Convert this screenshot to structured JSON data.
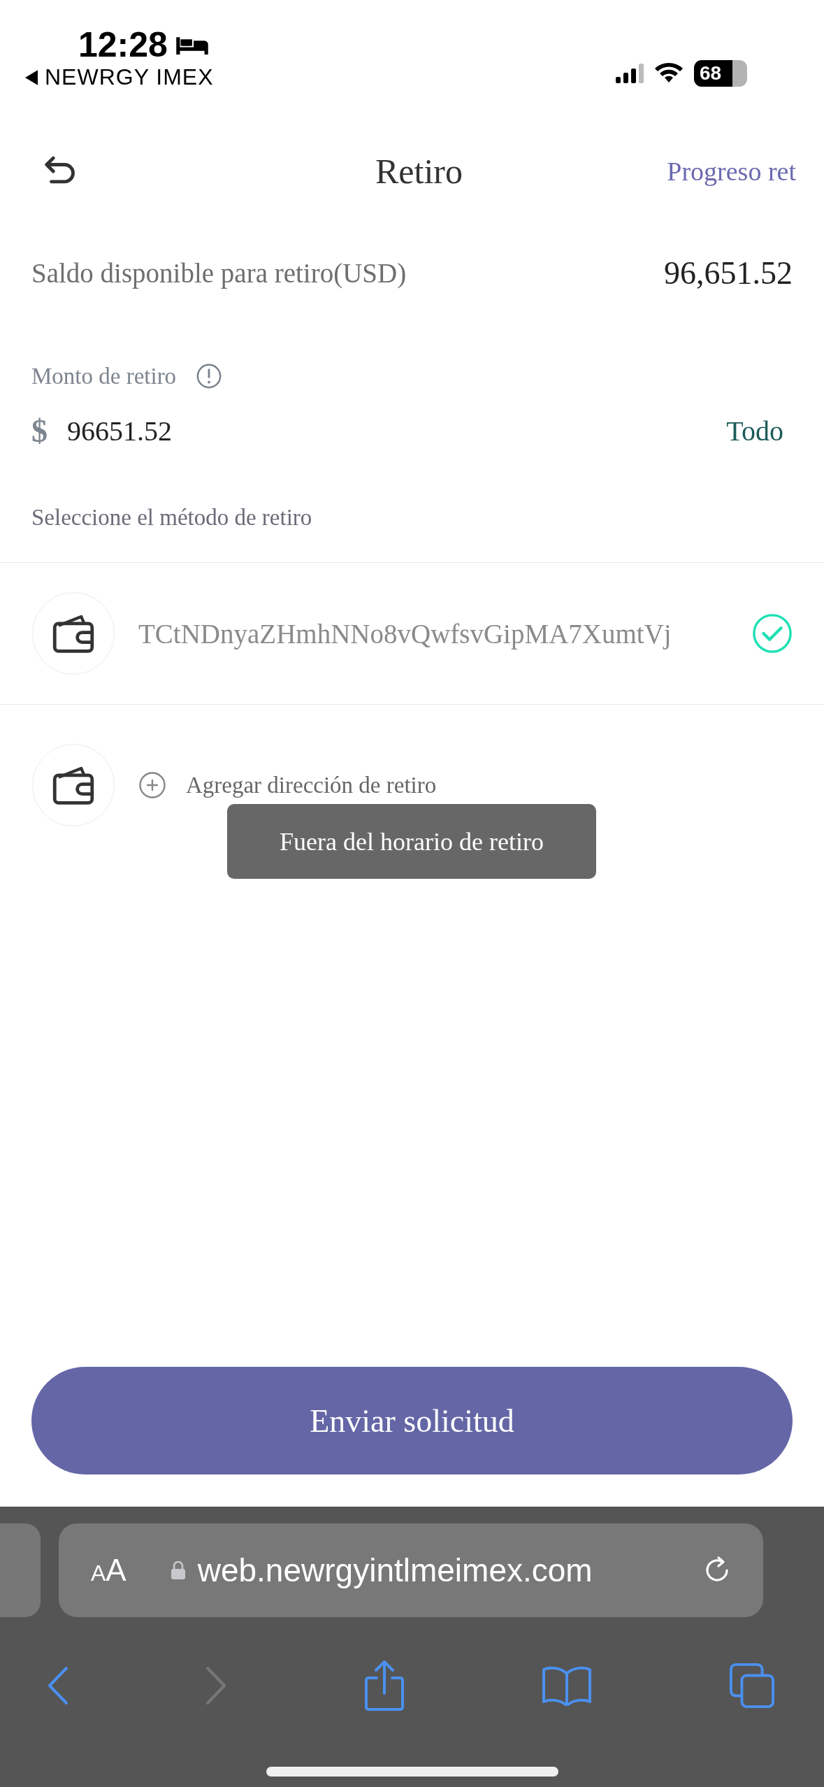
{
  "status_bar": {
    "time": "12:28",
    "back_app": "NEWRGY IMEX",
    "battery": "68"
  },
  "header": {
    "title": "Retiro",
    "link": "Progreso ret"
  },
  "balance": {
    "label": "Saldo disponible para retiro(USD)",
    "value": "96,651.52"
  },
  "amount": {
    "label": "Monto de retiro",
    "currency": "$",
    "value": "96651.52",
    "all_button": "Todo"
  },
  "method": {
    "label": "Seleccione el método de retiro",
    "addresses": [
      {
        "address": "TCtNDnyaZHmhNNo8vQwfsvGipMA7XumtVj",
        "selected": true
      }
    ],
    "add_label": "Agregar dirección de retiro"
  },
  "toast": "Fuera del horario de retiro",
  "submit_button": "Enviar solicitud",
  "browser": {
    "text_size_button": "AA",
    "url": "web.newrgyintlmeimex.com"
  }
}
